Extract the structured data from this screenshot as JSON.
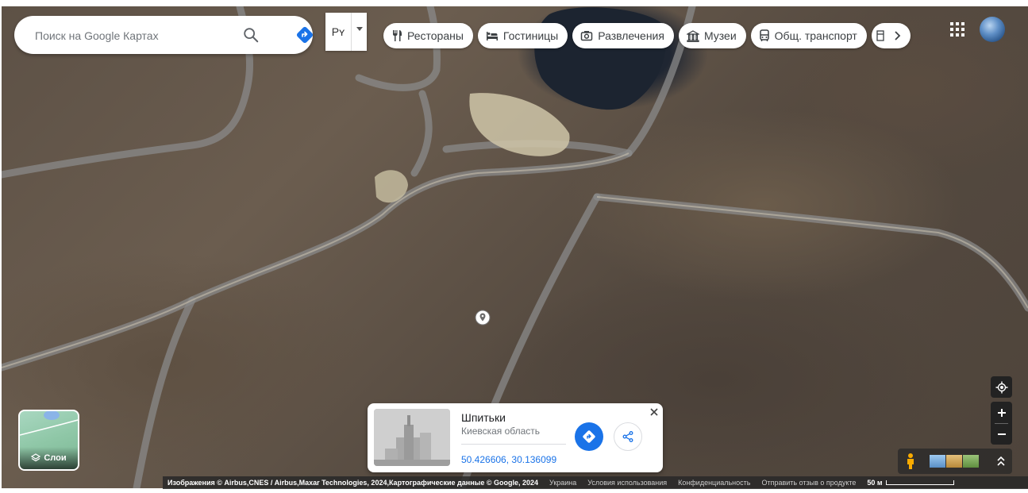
{
  "search": {
    "placeholder": "Поиск на Google Картах"
  },
  "language": {
    "label": "Рʏ"
  },
  "chips": [
    {
      "label": "Рестораны",
      "icon": "fork-knife-icon"
    },
    {
      "label": "Гостиницы",
      "icon": "bed-icon"
    },
    {
      "label": "Развлечения",
      "icon": "camera-icon"
    },
    {
      "label": "Музеи",
      "icon": "museum-icon"
    },
    {
      "label": "Общ. транспорт",
      "icon": "bus-icon"
    }
  ],
  "layers": {
    "label": "Слои"
  },
  "place_card": {
    "title": "Шпитьки",
    "subtitle": "Киевская область",
    "coordinates": "50.426606, 30.136099"
  },
  "footer": {
    "attribution": "Изображения © Airbus,CNES / Airbus,Maxar Technologies, 2024,Картографические данные © Google, 2024",
    "country": "Украина",
    "terms": "Условия использования",
    "privacy": "Конфиденциальность",
    "feedback": "Отправить отзыв о продукте",
    "scale": "50 м"
  },
  "colors": {
    "accent": "#1a73e8",
    "control_dark": "#222222"
  }
}
